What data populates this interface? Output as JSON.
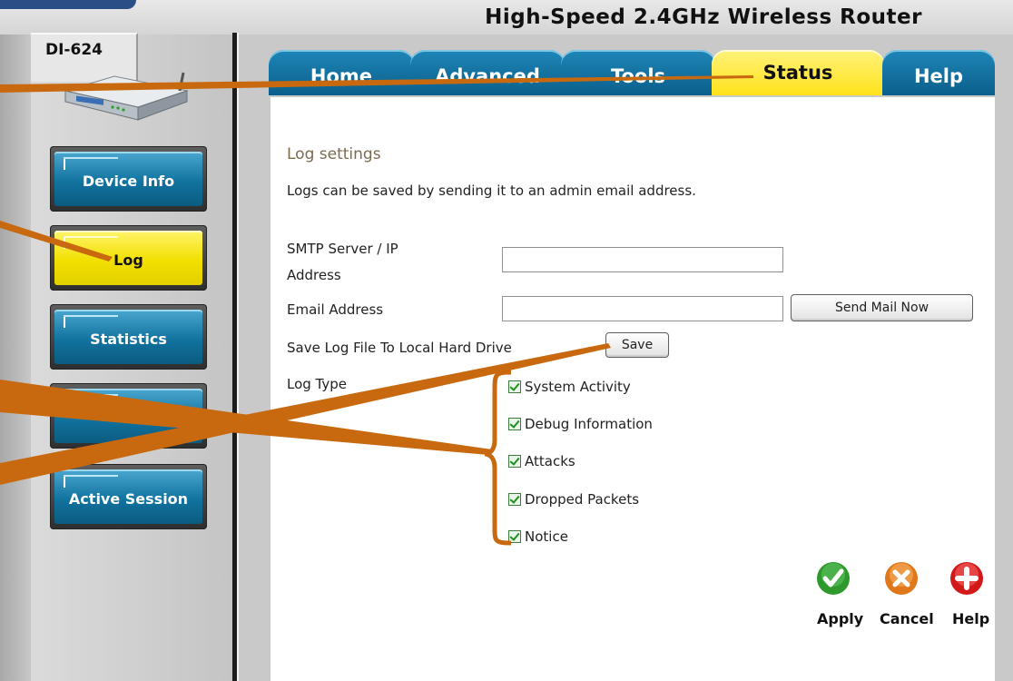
{
  "header": {
    "router_title": "High-Speed 2.4GHz Wireless Router"
  },
  "sidebar": {
    "model": "DI-624",
    "items": [
      {
        "label": "Device Info",
        "active": false
      },
      {
        "label": "Log",
        "active": true
      },
      {
        "label": "Statistics",
        "active": false
      },
      {
        "label": "",
        "active": false
      },
      {
        "label": "Active Session",
        "active": false
      }
    ]
  },
  "tabs": [
    {
      "label": "Home",
      "active": false
    },
    {
      "label": "Advanced",
      "active": false
    },
    {
      "label": "Tools",
      "active": false
    },
    {
      "label": "Status",
      "active": true
    },
    {
      "label": "Help",
      "active": false
    }
  ],
  "log_settings": {
    "title": "Log settings",
    "intro": "Logs can be saved by sending it to an admin email address.",
    "smtp_label_line1": "SMTP Server / IP",
    "smtp_label_line2": "Address",
    "smtp_value": "",
    "email_label": "Email Address",
    "email_value": "",
    "send_mail_button": "Send Mail Now",
    "save_log_label": "Save Log File To Local Hard Drive",
    "save_button": "Save",
    "log_type_label": "Log Type",
    "log_types": [
      {
        "label": "System Activity",
        "checked": true
      },
      {
        "label": "Debug Information",
        "checked": true
      },
      {
        "label": "Attacks",
        "checked": true
      },
      {
        "label": "Dropped Packets",
        "checked": true
      },
      {
        "label": "Notice",
        "checked": true
      }
    ]
  },
  "actions": {
    "apply": "Apply",
    "cancel": "Cancel",
    "help": "Help"
  },
  "colors": {
    "tab_blue": "#0a5f8b",
    "active_yellow": "#ffe21a",
    "callout_orange": "#c9690f",
    "apply_green": "#2e9a2e",
    "cancel_orange": "#e0781b",
    "help_red": "#d11919"
  }
}
